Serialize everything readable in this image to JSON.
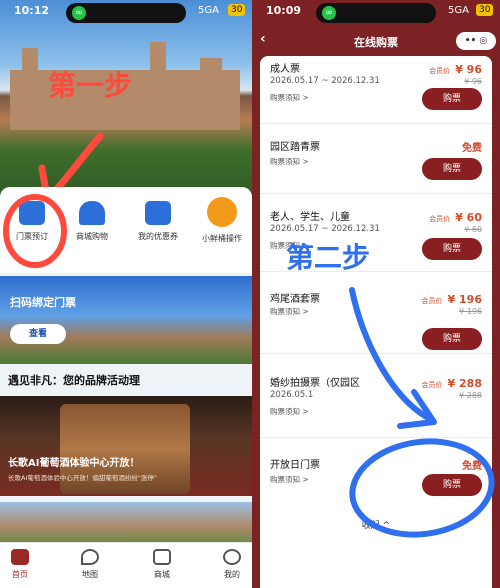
{
  "left": {
    "status": {
      "time": "10:12",
      "signal": "5GA",
      "battery": "30"
    },
    "annotation": "第一步",
    "shortcuts": [
      {
        "label": "门票预订",
        "icon": "ticket-icon"
      },
      {
        "label": "商城购物",
        "icon": "shopping-bell-icon"
      },
      {
        "label": "我的优惠券",
        "icon": "coupon-icon"
      },
      {
        "label": "小鲜桶操作",
        "icon": "orange-bucket-icon"
      }
    ],
    "banner_scan": {
      "title": "扫码绑定门票",
      "button": "查看"
    },
    "section_title": "遇见非凡：您的品牌活动理",
    "banner_ai": {
      "title": "长歌AI葡萄酒体验中心开放！",
      "subtitle": "长歌AI葡萄酒体验中心开放！偏甜葡萄酒纷纷\"涨停\""
    },
    "tabs": [
      {
        "label": "首页",
        "icon": "home-icon"
      },
      {
        "label": "地图",
        "icon": "map-pin-icon"
      },
      {
        "label": "商城",
        "icon": "store-icon"
      },
      {
        "label": "我的",
        "icon": "person-icon"
      }
    ],
    "colors": {
      "accent": "#9a2a25",
      "annotation": "#ff4a3d"
    }
  },
  "right": {
    "status": {
      "time": "10:09",
      "signal": "5GA",
      "battery": "30"
    },
    "nav": {
      "title": "在线购票",
      "capsule": "•• ◎"
    },
    "annotation": "第二步",
    "tickets": [
      {
        "name": "成人票",
        "date": "2026.05.17 ~ 2026.12.31",
        "notice": "购票须知 >",
        "member_label": "会员价",
        "price": "¥ 96",
        "original": "¥ 96",
        "free": "",
        "buy": "购票"
      },
      {
        "name": "园区踏青票",
        "date": "",
        "notice": "购票须知 >",
        "member_label": "",
        "price": "",
        "original": "",
        "free": "免费",
        "buy": "购票"
      },
      {
        "name": "老人、学生、儿童",
        "date": "2026.05.17 ~ 2026.12.31",
        "notice": "购票须知 >",
        "member_label": "会员价",
        "price": "¥ 60",
        "original": "¥ 60",
        "free": "",
        "buy": "购票"
      },
      {
        "name": "鸡尾酒套票",
        "date": "",
        "notice": "购票须知 >",
        "member_label": "会员价",
        "price": "¥ 196",
        "original": "¥ 196",
        "free": "",
        "buy": "购票"
      },
      {
        "name": "婚纱拍摄票（仅园区",
        "date": "2026.05.1",
        "notice": "购票须知 >",
        "member_label": "会员价",
        "price": "¥ 288",
        "original": "¥ 288",
        "free": "",
        "buy": "购票"
      },
      {
        "name": "开放日门票",
        "date": "",
        "notice": "购票须知 >",
        "member_label": "",
        "price": "",
        "original": "",
        "free": "免费",
        "buy": "购票"
      }
    ],
    "collapse_label": "收起 ^",
    "colors": {
      "background": "#7d2224",
      "button": "#8a1f22",
      "price": "#d74a2a",
      "annotation": "#2f6ff0"
    }
  }
}
